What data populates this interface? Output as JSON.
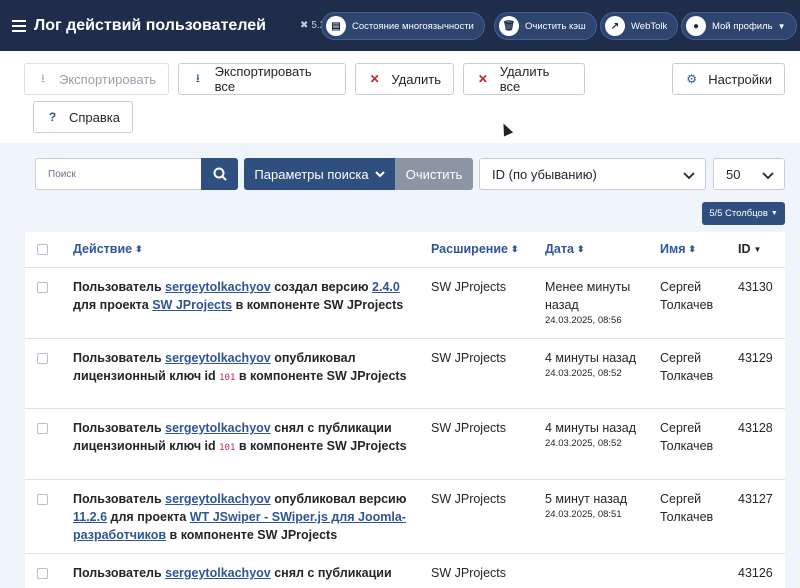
{
  "header": {
    "title": "Лог действий пользователей",
    "version": "5.2.5",
    "buttons": {
      "multilang": "Состояние многоязычности",
      "cache": "Очистить кэш",
      "webtolk": "WebTolk",
      "profile": "Мой профиль"
    }
  },
  "toolbar": {
    "export": "Экспортировать",
    "export_all": "Экспортировать все",
    "delete": "Удалить",
    "delete_all": "Удалить все",
    "settings": "Настройки",
    "help": "Справка"
  },
  "search": {
    "placeholder": "Поиск",
    "params": "Параметры поиска",
    "clear": "Очистить",
    "sort": "ID (по убыванию)",
    "limit": "50",
    "columns": "5/5 Столбцов"
  },
  "table": {
    "headers": {
      "action": "Действие",
      "extension": "Расширение",
      "date": "Дата",
      "name": "Имя",
      "id": "ID"
    },
    "rows": [
      {
        "a1": "Пользователь ",
        "user": "sergeytolkachyov",
        "a2": " создал версию ",
        "link1": "2.4.0",
        "a3": " для проекта ",
        "link2": "SW JProjects",
        "a4": " в компоненте SW JProjects",
        "ext": "SW JProjects",
        "when": "Менее минуты назад",
        "date": "24.03.2025, 08:56",
        "name": "Сергей Толкачев",
        "id": "43130"
      },
      {
        "a1": "Пользователь ",
        "user": "sergeytolkachyov",
        "a2": " опубликовал лицензионный ключ id ",
        "code": "101",
        "a3": " в компоненте SW JProjects",
        "ext": "SW JProjects",
        "when": "4 минуты назад",
        "date": "24.03.2025, 08:52",
        "name": "Сергей Толкачев",
        "id": "43129"
      },
      {
        "a1": "Пользователь ",
        "user": "sergeytolkachyov",
        "a2": " снял с публикации лицензионный ключ id ",
        "code": "101",
        "a3": " в компоненте SW JProjects",
        "ext": "SW JProjects",
        "when": "4 минуты назад",
        "date": "24.03.2025, 08:52",
        "name": "Сергей Толкачев",
        "id": "43128"
      },
      {
        "a1": "Пользователь ",
        "user": "sergeytolkachyov",
        "a2": " опубликовал версию ",
        "link1": "11.2.6",
        "a3": " для проекта ",
        "link2": "WT JSwiper - SWiper.js для Joomla-разработчиков",
        "a4": " в компоненте SW JProjects",
        "ext": "SW JProjects",
        "when": "5 минут назад",
        "date": "24.03.2025, 08:51",
        "name": "Сергей Толкачев",
        "id": "43127"
      },
      {
        "a1": "Пользователь ",
        "user": "sergeytolkachyov",
        "a2": " снял с публикации",
        "ext": "SW JProjects",
        "when": "",
        "date": "",
        "name": "",
        "id": "43126"
      }
    ]
  }
}
